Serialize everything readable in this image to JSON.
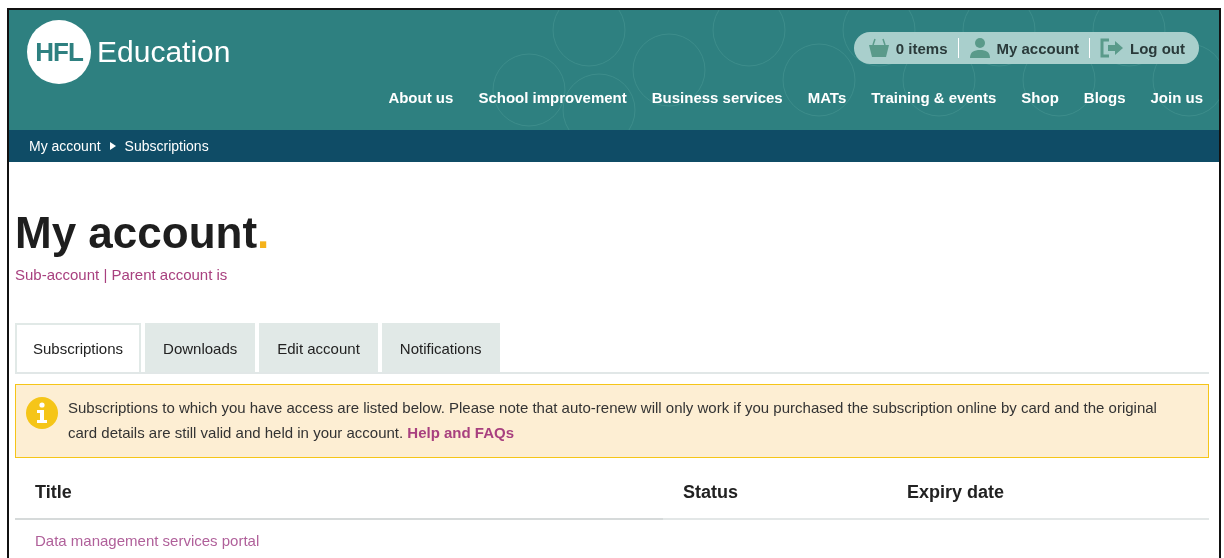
{
  "header": {
    "logo": {
      "mark": "HFL",
      "name": "Education"
    },
    "utility": [
      {
        "kind": "basket",
        "label": "0 items"
      },
      {
        "kind": "person",
        "label": "My account"
      },
      {
        "kind": "logout",
        "label": "Log out"
      }
    ],
    "nav": [
      "About us",
      "School improvement",
      "Business services",
      "MATs",
      "Training & events",
      "Shop",
      "Blogs",
      "Join us"
    ]
  },
  "breadcrumb": [
    "My account",
    "Subscriptions"
  ],
  "page": {
    "title": "My account",
    "title_dot": ".",
    "subtitle": "Sub-account | Parent account is"
  },
  "tabs": [
    {
      "label": "Subscriptions",
      "selected": true
    },
    {
      "label": "Downloads",
      "selected": false
    },
    {
      "label": "Edit account",
      "selected": false
    },
    {
      "label": "Notifications",
      "selected": false
    }
  ],
  "notice": {
    "text": "Subscriptions to which you have access are listed below. Please note that auto-renew will only work if you purchased the subscription online by card and the original card details are still valid and held in your account.",
    "link": "Help and FAQs"
  },
  "table": {
    "columns": [
      "Title",
      "Status",
      "Expiry date"
    ],
    "rows": [
      {
        "title": "Data management services portal"
      }
    ]
  }
}
